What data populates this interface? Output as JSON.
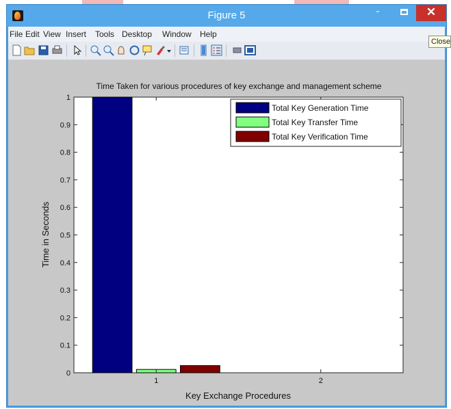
{
  "window": {
    "title": "Figure 5"
  },
  "controls": {
    "minimize": "-",
    "close": "✕"
  },
  "menu": [
    "File",
    "Edit",
    "View",
    "Insert",
    "Tools",
    "Desktop",
    "Window",
    "Help"
  ],
  "tooltip": "Close",
  "toolbar_icons": [
    "new-figure-icon",
    "open-file-icon",
    "save-icon",
    "print-icon",
    "pointer-icon",
    "zoom-in-icon",
    "zoom-out-icon",
    "pan-icon",
    "rotate-icon",
    "data-cursor-icon",
    "brush-icon",
    "brush-dropdown-icon",
    "link-icon",
    "colorbar-icon",
    "legend-icon",
    "hide-plot-tools-icon",
    "show-plot-tools-icon"
  ],
  "chart_data": {
    "type": "bar",
    "title": "Time Taken for various procedures of key exchange and management scheme",
    "xlabel": "Key Exchange Procedures",
    "ylabel": "Time in Seconds",
    "categories": [
      "1",
      "2"
    ],
    "ylim": [
      0,
      1
    ],
    "yticks": [
      "0",
      "0.1",
      "0.2",
      "0.3",
      "0.4",
      "0.5",
      "0.6",
      "0.7",
      "0.8",
      "0.9",
      "1"
    ],
    "legend_position": "top-right",
    "series": [
      {
        "name": "Total Key Generation Time",
        "color": "#000080",
        "values": [
          1.0,
          null
        ]
      },
      {
        "name": "Total Key Transfer Time",
        "color": "#80ff80",
        "values": [
          0.012,
          null
        ]
      },
      {
        "name": "Total Key Verification Time",
        "color": "#800000",
        "values": [
          0.026,
          null
        ]
      }
    ]
  }
}
